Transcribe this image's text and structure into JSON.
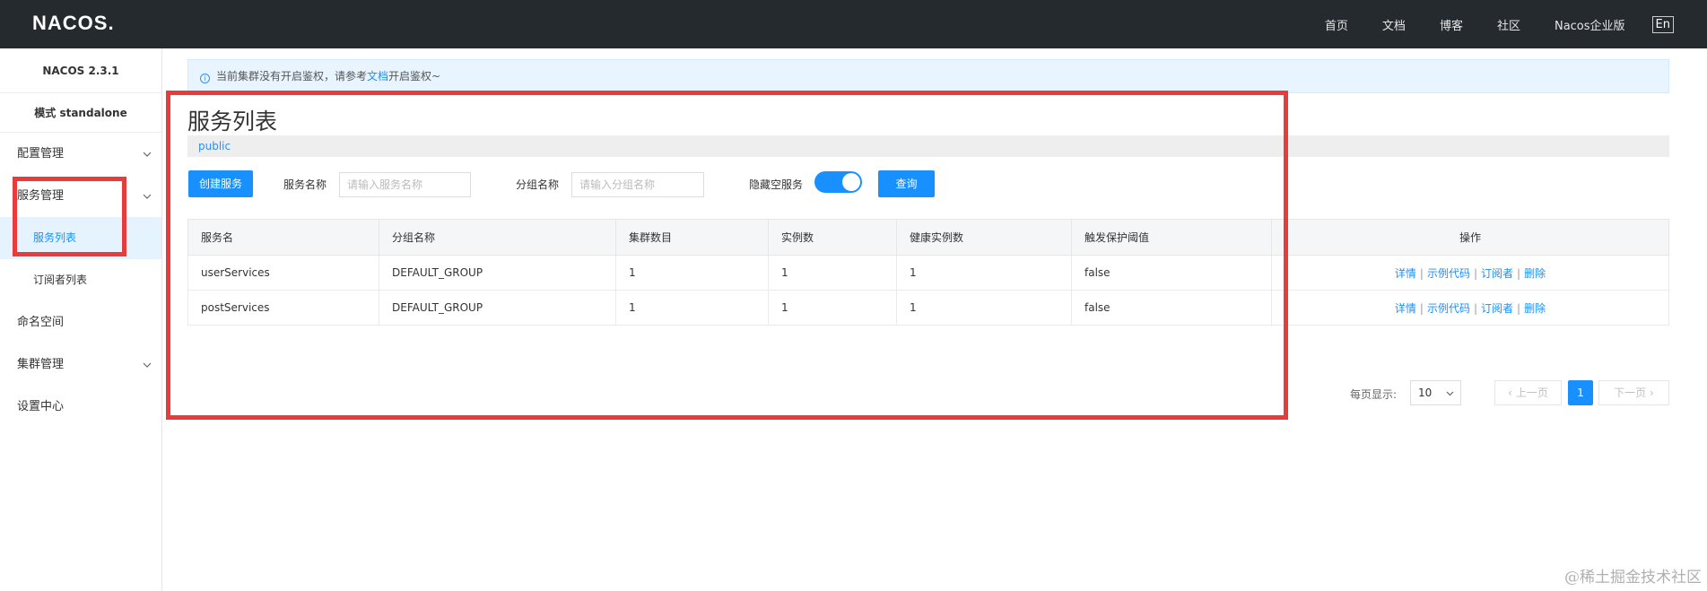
{
  "header": {
    "logo": "NACOS.",
    "nav": [
      "首页",
      "文档",
      "博客",
      "社区",
      "Nacos企业版"
    ],
    "lang": "En"
  },
  "sidebar": {
    "version": "NACOS 2.3.1",
    "mode": "模式 standalone",
    "items": [
      {
        "label": "配置管理"
      },
      {
        "label": "服务管理"
      },
      {
        "label": "服务列表"
      },
      {
        "label": "订阅者列表"
      },
      {
        "label": "命名空间"
      },
      {
        "label": "集群管理"
      },
      {
        "label": "设置中心"
      }
    ]
  },
  "notice": {
    "prefix": "当前集群没有开启鉴权，请参考",
    "link": "文档",
    "suffix": "开启鉴权~"
  },
  "page": {
    "title": "服务列表",
    "namespace": "public"
  },
  "toolbar": {
    "create_label": "创建服务",
    "service_name_label": "服务名称",
    "service_name_placeholder": "请输入服务名称",
    "group_name_label": "分组名称",
    "group_name_placeholder": "请输入分组名称",
    "hide_empty_label": "隐藏空服务",
    "hide_empty_on": true,
    "query_label": "查询"
  },
  "table": {
    "columns": [
      "服务名",
      "分组名称",
      "集群数目",
      "实例数",
      "健康实例数",
      "触发保护阈值",
      "操作"
    ],
    "rows": [
      {
        "name": "userServices",
        "group": "DEFAULT_GROUP",
        "clusters": "1",
        "instances": "1",
        "healthy": "1",
        "threshold": "false"
      },
      {
        "name": "postServices",
        "group": "DEFAULT_GROUP",
        "clusters": "1",
        "instances": "1",
        "healthy": "1",
        "threshold": "false"
      }
    ],
    "actions": [
      "详情",
      "示例代码",
      "订阅者",
      "删除"
    ]
  },
  "pagination": {
    "per_page_label": "每页显示:",
    "per_page_value": "10",
    "prev_label": "上一页",
    "current_page": "1",
    "next_label": "下一页"
  },
  "watermark": "@稀土掘金技术社区",
  "colors": {
    "accent": "#1890ff",
    "topbar": "#252a2f",
    "highlight": "#e83b3b"
  }
}
